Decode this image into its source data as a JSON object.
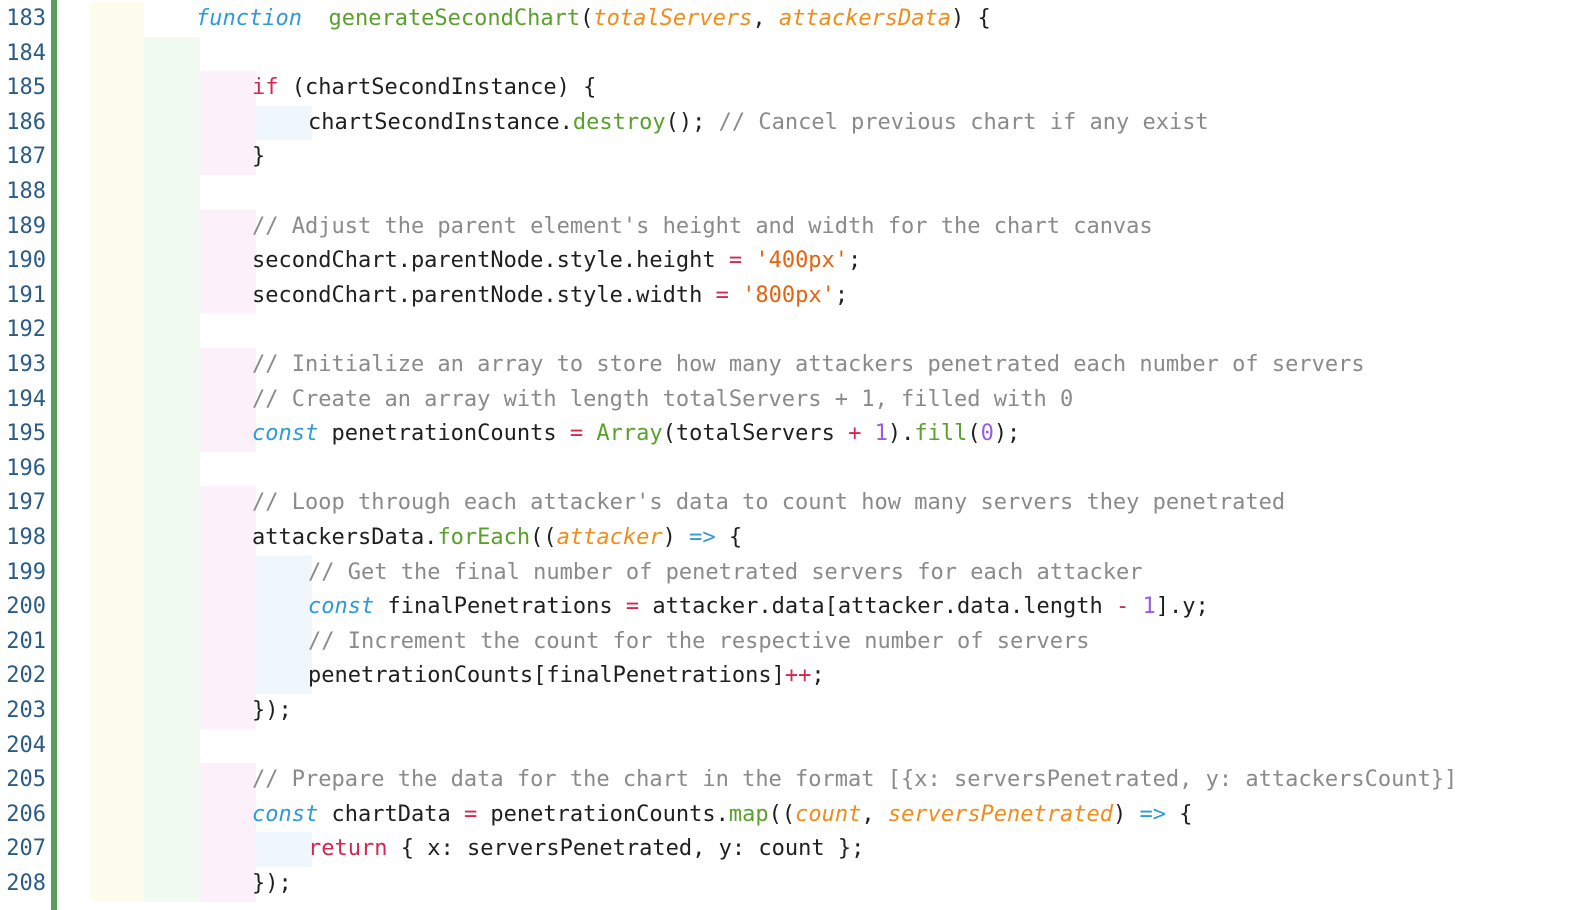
{
  "editor": {
    "lines": [
      {
        "n": "183",
        "indent": 0,
        "tokens": [
          [
            "kwi",
            "function"
          ],
          [
            "",
            "  "
          ],
          [
            "fn",
            "generateSecondChart"
          ],
          [
            "",
            "("
          ],
          [
            "par",
            "totalServers"
          ],
          [
            "",
            ", "
          ],
          [
            "par",
            "attackersData"
          ],
          [
            "",
            ") {"
          ]
        ]
      },
      {
        "n": "184",
        "indent": 1,
        "tokens": []
      },
      {
        "n": "185",
        "indent": 2,
        "tokens": [
          [
            "kw",
            "if"
          ],
          [
            "",
            " (chartSecondInstance) {"
          ]
        ]
      },
      {
        "n": "186",
        "indent": 3,
        "tokens": [
          [
            "",
            "chartSecondInstance."
          ],
          [
            "fn",
            "destroy"
          ],
          [
            "",
            "(); "
          ],
          [
            "cmt",
            "// Cancel previous chart if any exist"
          ]
        ]
      },
      {
        "n": "187",
        "indent": 2,
        "tokens": [
          [
            "",
            "}"
          ]
        ]
      },
      {
        "n": "188",
        "indent": 1,
        "tokens": []
      },
      {
        "n": "189",
        "indent": 2,
        "tokens": [
          [
            "cmt",
            "// Adjust the parent element's height and width for the chart canvas"
          ]
        ]
      },
      {
        "n": "190",
        "indent": 2,
        "tokens": [
          [
            "",
            "secondChart.parentNode.style.height "
          ],
          [
            "op",
            "="
          ],
          [
            "",
            " "
          ],
          [
            "str",
            "'400px'"
          ],
          [
            "",
            ";"
          ]
        ]
      },
      {
        "n": "191",
        "indent": 2,
        "tokens": [
          [
            "",
            "secondChart.parentNode.style.width "
          ],
          [
            "op",
            "="
          ],
          [
            "",
            " "
          ],
          [
            "str",
            "'800px'"
          ],
          [
            "",
            ";"
          ]
        ]
      },
      {
        "n": "192",
        "indent": 1,
        "tokens": []
      },
      {
        "n": "193",
        "indent": 2,
        "tokens": [
          [
            "cmt",
            "// Initialize an array to store how many attackers penetrated each number of servers"
          ]
        ]
      },
      {
        "n": "194",
        "indent": 2,
        "tokens": [
          [
            "cmt",
            "// Create an array with length totalServers + 1, filled with 0"
          ]
        ]
      },
      {
        "n": "195",
        "indent": 2,
        "tokens": [
          [
            "kwi",
            "const"
          ],
          [
            "",
            " penetrationCounts "
          ],
          [
            "op",
            "="
          ],
          [
            "",
            " "
          ],
          [
            "fn",
            "Array"
          ],
          [
            "",
            "(totalServers "
          ],
          [
            "op",
            "+"
          ],
          [
            "",
            " "
          ],
          [
            "num",
            "1"
          ],
          [
            "",
            ")."
          ],
          [
            "fn",
            "fill"
          ],
          [
            "",
            "("
          ],
          [
            "num",
            "0"
          ],
          [
            "",
            ");"
          ]
        ]
      },
      {
        "n": "196",
        "indent": 1,
        "tokens": []
      },
      {
        "n": "197",
        "indent": 2,
        "tokens": [
          [
            "cmt",
            "// Loop through each attacker's data to count how many servers they penetrated"
          ]
        ]
      },
      {
        "n": "198",
        "indent": 2,
        "tokens": [
          [
            "",
            "attackersData."
          ],
          [
            "fn",
            "forEach"
          ],
          [
            "",
            "(("
          ],
          [
            "par",
            "attacker"
          ],
          [
            "",
            ") "
          ],
          [
            "arw",
            "=>"
          ],
          [
            "",
            " {"
          ]
        ]
      },
      {
        "n": "199",
        "indent": 3,
        "tokens": [
          [
            "cmt",
            "// Get the final number of penetrated servers for each attacker"
          ]
        ]
      },
      {
        "n": "200",
        "indent": 3,
        "tokens": [
          [
            "kwi",
            "const"
          ],
          [
            "",
            " finalPenetrations "
          ],
          [
            "op",
            "="
          ],
          [
            "",
            " attacker.data[attacker.data.length "
          ],
          [
            "op",
            "-"
          ],
          [
            "",
            " "
          ],
          [
            "num",
            "1"
          ],
          [
            "",
            "].y;"
          ]
        ]
      },
      {
        "n": "201",
        "indent": 3,
        "tokens": [
          [
            "cmt",
            "// Increment the count for the respective number of servers"
          ]
        ]
      },
      {
        "n": "202",
        "indent": 3,
        "tokens": [
          [
            "",
            "penetrationCounts[finalPenetrations]"
          ],
          [
            "op",
            "++"
          ],
          [
            "",
            ";"
          ]
        ]
      },
      {
        "n": "203",
        "indent": 2,
        "tokens": [
          [
            "",
            "});"
          ]
        ]
      },
      {
        "n": "204",
        "indent": 1,
        "tokens": []
      },
      {
        "n": "205",
        "indent": 2,
        "tokens": [
          [
            "cmt",
            "// Prepare the data for the chart in the format [{x: serversPenetrated, y: attackersCount}]"
          ]
        ]
      },
      {
        "n": "206",
        "indent": 2,
        "tokens": [
          [
            "kwi",
            "const"
          ],
          [
            "",
            " chartData "
          ],
          [
            "op",
            "="
          ],
          [
            "",
            " penetrationCounts."
          ],
          [
            "fn",
            "map"
          ],
          [
            "",
            "(("
          ],
          [
            "par",
            "count"
          ],
          [
            "",
            ", "
          ],
          [
            "par",
            "serversPenetrated"
          ],
          [
            "",
            ") "
          ],
          [
            "arw",
            "=>"
          ],
          [
            "",
            " {"
          ]
        ]
      },
      {
        "n": "207",
        "indent": 3,
        "tokens": [
          [
            "kw",
            "return"
          ],
          [
            "",
            " { x: serversPenetrated, y: count };"
          ]
        ]
      },
      {
        "n": "208",
        "indent": 2,
        "tokens": [
          [
            "",
            "});"
          ]
        ]
      }
    ]
  }
}
